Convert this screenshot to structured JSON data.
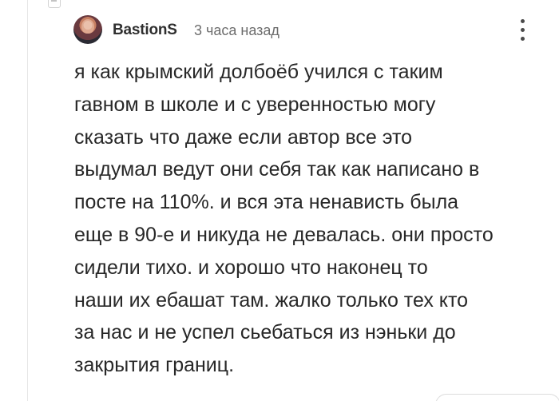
{
  "comment": {
    "author": "BastionS",
    "timestamp": "3 часа назад",
    "text": "я как крымский долбоёб учился с таким\nгавном в школе и с уверенностью могу\nсказать что даже если автор все это\nвыдумал ведут они себя так как написано в\nпосте на 110%. и вся эта ненависть была\nеще в 90-е и никуда не девалась. они просто\nсидели тихо. и хорошо что наконец то\nнаши их ебашат там. жалко только тех кто\nза нас и не успел сьебаться из нэньки до\nзакрытия границ."
  },
  "icons": {
    "more": "vertical-dots-icon",
    "collapse": "collapse-minus-icon"
  },
  "colors": {
    "background": "#ffffff",
    "text": "#282828",
    "muted": "#6d6d6d",
    "thread_line": "#e6e6e6"
  }
}
